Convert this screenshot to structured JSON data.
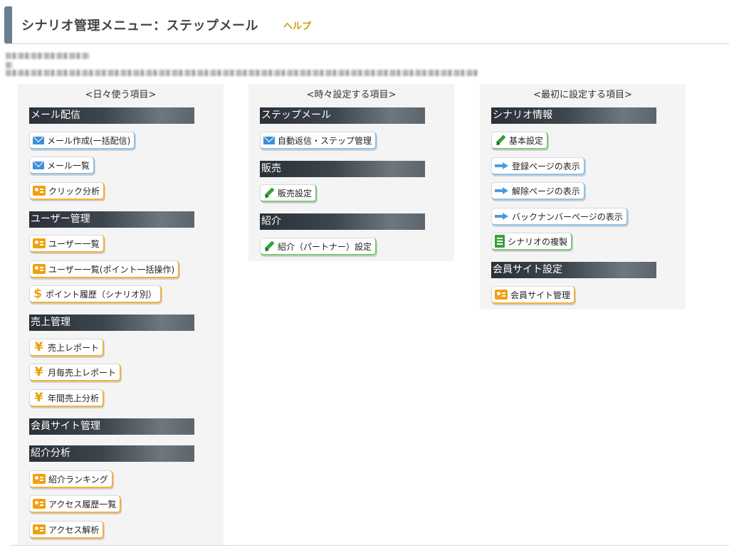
{
  "header": {
    "title": "シナリオ管理メニュー：ステップメール",
    "help_label": "ヘルプ"
  },
  "col_daily": {
    "heading": "<日々使う項目>",
    "sections": [
      {
        "label": "メール配信",
        "buttons": [
          {
            "label": "メール作成(一括配信)",
            "icon": "mail-icon",
            "color": "blue"
          },
          {
            "label": "メール一覧",
            "icon": "mail-icon",
            "color": "blue"
          },
          {
            "label": "クリック分析",
            "icon": "user-card-icon",
            "color": "orange"
          }
        ]
      },
      {
        "label": "ユーザー管理",
        "buttons": [
          {
            "label": "ユーザー一覧",
            "icon": "user-card-icon",
            "color": "orange"
          },
          {
            "label": "ユーザー一覧(ポイント一括操作)",
            "icon": "user-card-icon",
            "color": "orange"
          },
          {
            "label": "ポイント履歴（シナリオ別）",
            "icon": "dollar-icon",
            "color": "orange"
          }
        ]
      },
      {
        "label": "売上管理",
        "buttons": [
          {
            "label": "売上レポート",
            "icon": "yen-icon",
            "color": "orange"
          },
          {
            "label": "月毎売上レポート",
            "icon": "yen-icon",
            "color": "orange"
          },
          {
            "label": "年間売上分析",
            "icon": "yen-icon",
            "color": "orange"
          }
        ]
      },
      {
        "label": "会員サイト管理",
        "buttons": []
      },
      {
        "label": "紹介分析",
        "buttons": [
          {
            "label": "紹介ランキング",
            "icon": "user-card-icon",
            "color": "orange"
          },
          {
            "label": "アクセス履歴一覧",
            "icon": "user-card-icon",
            "color": "orange"
          },
          {
            "label": "アクセス解析",
            "icon": "user-card-icon",
            "color": "orange"
          }
        ]
      }
    ]
  },
  "col_sometimes": {
    "heading": "<時々設定する項目>",
    "sections": [
      {
        "label": "ステップメール",
        "buttons": [
          {
            "label": "自動返信・ステップ管理",
            "icon": "mail-icon",
            "color": "blue"
          }
        ]
      },
      {
        "label": "販売",
        "buttons": [
          {
            "label": "販売設定",
            "icon": "pencil-icon",
            "color": "green"
          }
        ]
      },
      {
        "label": "紹介",
        "buttons": [
          {
            "label": "紹介（パートナー）設定",
            "icon": "pencil-icon",
            "color": "green"
          }
        ]
      }
    ]
  },
  "col_first": {
    "heading": "<最初に設定する項目>",
    "sections": [
      {
        "label": "シナリオ情報",
        "buttons": [
          {
            "label": "基本設定",
            "icon": "pencil-icon",
            "color": "green"
          },
          {
            "label": "登録ページの表示",
            "icon": "arrow-right-icon",
            "color": "blue"
          },
          {
            "label": "解除ページの表示",
            "icon": "arrow-right-icon",
            "color": "blue"
          },
          {
            "label": "バックナンバーページの表示",
            "icon": "arrow-right-icon",
            "color": "blue"
          },
          {
            "label": "シナリオの複製",
            "icon": "document-icon",
            "color": "green"
          }
        ]
      },
      {
        "label": "会員サイト設定",
        "buttons": [
          {
            "label": "会員サイト管理",
            "icon": "user-card-icon",
            "color": "orange"
          }
        ]
      }
    ]
  }
}
